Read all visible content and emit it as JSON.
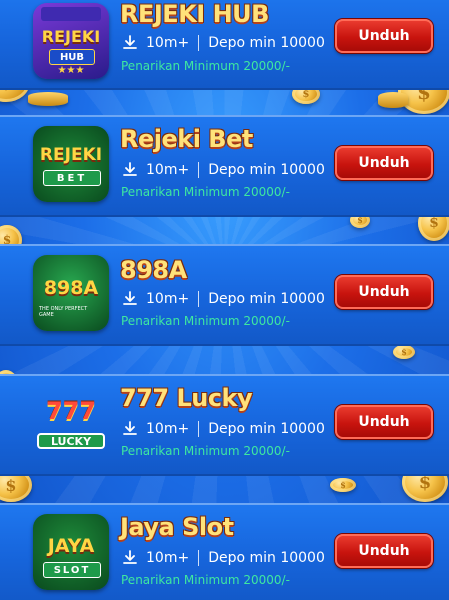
{
  "apps": [
    {
      "name": "REJEKI HUB",
      "downloads": "10m+",
      "deposit": "Depo min 10000",
      "note": "Penarikan Minimum 20000/-",
      "button": "Unduh",
      "icon_text": "REJEKI",
      "icon_sub": "HUB"
    },
    {
      "name": "Rejeki Bet",
      "downloads": "10m+",
      "deposit": "Depo min 10000",
      "note": "Penarikan Minimum 20000/-",
      "button": "Unduh",
      "icon_text": "REJEKI",
      "icon_sub": "BET"
    },
    {
      "name": "898A",
      "downloads": "10m+",
      "deposit": "Depo min 10000",
      "note": "Penarikan Minimum 20000/-",
      "button": "Unduh",
      "icon_text": "898A",
      "icon_sub": "THE ONLY PERFECT GAME"
    },
    {
      "name": "777 Lucky",
      "downloads": "10m+",
      "deposit": "Depo min 10000",
      "note": "Penarikan Minimum 20000/-",
      "button": "Unduh",
      "icon_text": "777",
      "icon_sub": "LUCKY"
    },
    {
      "name": "Jaya Slot",
      "downloads": "10m+",
      "deposit": "Depo min 10000",
      "note": "Penarikan Minimum 20000/-",
      "button": "Unduh",
      "icon_text": "JAYA",
      "icon_sub": "SLOT"
    }
  ],
  "icons": {
    "download": "download-icon",
    "coin": "dollar-coin-icon"
  },
  "colors": {
    "background": "#1c6ee8",
    "title": "#ffe27a",
    "note": "#3ee8a0",
    "button": "#c8140e"
  }
}
